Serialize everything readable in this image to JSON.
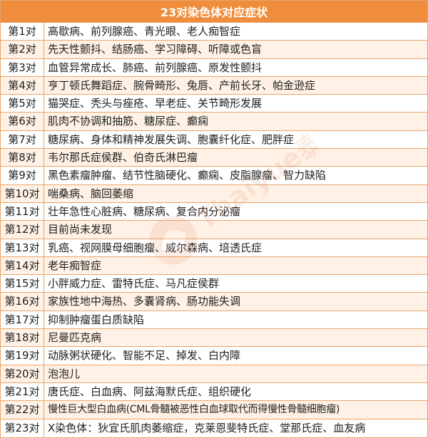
{
  "title": "23对染色体对应症状",
  "rows": [
    {
      "label": "第1对",
      "symptoms": "高歇病、前列腺癌、青光眼、老人痴智症"
    },
    {
      "label": "第2对",
      "symptoms": "先天性颤抖、结肠癌、学习障碍、听障或色盲"
    },
    {
      "label": "第3对",
      "symptoms": "血管异常成长、肺癌、前列腺癌、原发性颤抖"
    },
    {
      "label": "第4对",
      "symptoms": "亨丁顿氏舞蹈症、腕骨畸形、兔唇、产前长牙、帕金逊症"
    },
    {
      "label": "第5对",
      "symptoms": "猫哭症、秃头与痤疮、早老症、关节畸形发展"
    },
    {
      "label": "第6对",
      "symptoms": "肌肉不协调和抽筋、糖尿症、癫痫"
    },
    {
      "label": "第7对",
      "symptoms": "糖尿病、身体和精神发展失调、胞囊纤化症、肥胖症"
    },
    {
      "label": "第8对",
      "symptoms": "韦尔那氏症侯群、伯奇氏淋巴瘤"
    },
    {
      "label": "第9对",
      "symptoms": "黑色素瘤肿瘤、结节性脑硬化、癫痫、皮脂腺瘤、智力缺陷"
    },
    {
      "label": "第10对",
      "symptoms": "喘桑病、脑回萎缩"
    },
    {
      "label": "第11对",
      "symptoms": "壮年急性心脏病、糖尿病、复合内分泌瘤"
    },
    {
      "label": "第12对",
      "symptoms": "目前尚未发现"
    },
    {
      "label": "第13对",
      "symptoms": "乳癌、视网膜母细胞瘤、威尔森病、培透氏症"
    },
    {
      "label": "第14对",
      "symptoms": "老年痴智症"
    },
    {
      "label": "第15对",
      "symptoms": "小胖威力症、雷特氏症、马凡症侯群"
    },
    {
      "label": "第16对",
      "symptoms": "家族性地中海热、多囊肾病、肠功能失调"
    },
    {
      "label": "第17对",
      "symptoms": "抑制肿瘤蛋白质缺陷"
    },
    {
      "label": "第18对",
      "symptoms": "尼曼匹克病"
    },
    {
      "label": "第19对",
      "symptoms": "动脉粥状硬化、智能不足、掉发、白内障"
    },
    {
      "label": "第20对",
      "symptoms": "泡泡儿"
    },
    {
      "label": "第21对",
      "symptoms": "唐氏症、白血病、阿兹海默氏症、组织硬化"
    },
    {
      "label": "第22对",
      "symptoms": "慢性巨大型白血病(CML骨髓被恶性白血球取代而得慢性骨髓细胞瘤)"
    },
    {
      "label": "第23对",
      "symptoms": "X染色体：狄宜氏肌肉萎缩症，克莱恩斐特氏症、堂那氏症、血友病"
    }
  ],
  "watermark": {
    "text": "Thaiyue泰悦"
  },
  "colors": {
    "header_bg": "#ef8d3d",
    "border": "#e8a66f",
    "stripe": "#fff1e5",
    "watermark": "#e0703a"
  }
}
